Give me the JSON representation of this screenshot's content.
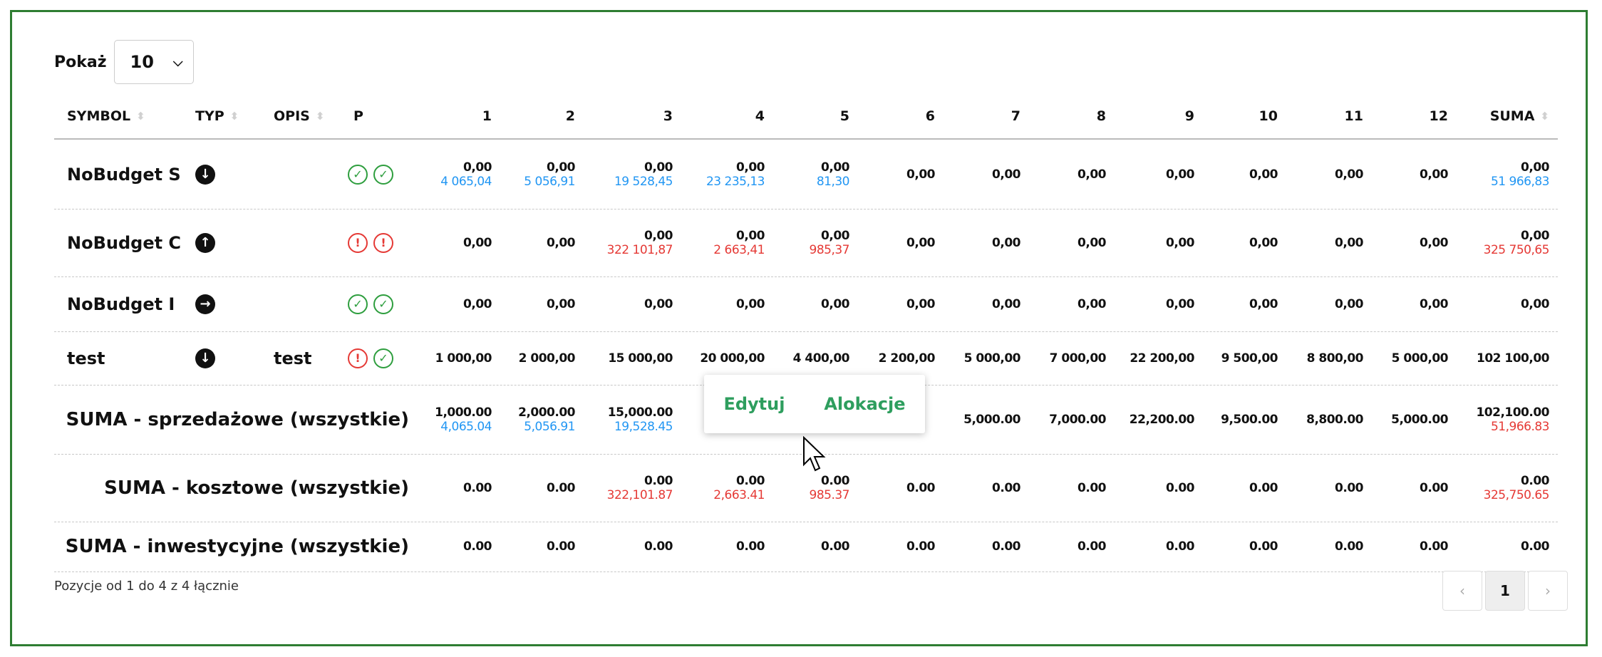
{
  "show": {
    "label": "Pokaż",
    "value": "10"
  },
  "headers": [
    "SYMBOL",
    "TYP",
    "OPIS",
    "P",
    "1",
    "2",
    "3",
    "4",
    "5",
    "6",
    "7",
    "8",
    "9",
    "10",
    "11",
    "12",
    "SUMA"
  ],
  "rows": [
    {
      "symbol": "NoBudget S",
      "type": "down-arrow-icon",
      "opis": "",
      "status": [
        "ok",
        "ok"
      ],
      "values": [
        [
          "0,00",
          "4 065,04"
        ],
        [
          "0,00",
          "5 056,91"
        ],
        [
          "0,00",
          "19 528,45"
        ],
        [
          "0,00",
          "23 235,13"
        ],
        [
          "0,00",
          "81,30"
        ],
        [
          "0,00"
        ],
        [
          "0,00"
        ],
        [
          "0,00"
        ],
        [
          "0,00"
        ],
        [
          "0,00"
        ],
        [
          "0,00"
        ],
        [
          "0,00"
        ]
      ],
      "suma": [
        "0,00",
        "51 966,83"
      ],
      "subcolor": "#2196f3"
    },
    {
      "symbol": "NoBudget C",
      "type": "up-arrow-icon",
      "opis": "",
      "status": [
        "warn",
        "warn"
      ],
      "values": [
        [
          "0,00"
        ],
        [
          "0,00"
        ],
        [
          "0,00",
          "322 101,87"
        ],
        [
          "0,00",
          "2 663,41"
        ],
        [
          "0,00",
          "985,37"
        ],
        [
          "0,00"
        ],
        [
          "0,00"
        ],
        [
          "0,00"
        ],
        [
          "0,00"
        ],
        [
          "0,00"
        ],
        [
          "0,00"
        ],
        [
          "0,00"
        ]
      ],
      "suma": [
        "0,00",
        "325 750,65"
      ],
      "subcolor": "#e53935"
    },
    {
      "symbol": "NoBudget I",
      "type": "right-arrow-icon",
      "opis": "",
      "status": [
        "ok",
        "ok"
      ],
      "values": [
        [
          "0,00"
        ],
        [
          "0,00"
        ],
        [
          "0,00"
        ],
        [
          "0,00"
        ],
        [
          "0,00"
        ],
        [
          "0,00"
        ],
        [
          "0,00"
        ],
        [
          "0,00"
        ],
        [
          "0,00"
        ],
        [
          "0,00"
        ],
        [
          "0,00"
        ],
        [
          "0,00"
        ]
      ],
      "suma": [
        "0,00"
      ],
      "subcolor": "#2196f3"
    },
    {
      "symbol": "test",
      "type": "down-arrow-icon",
      "opis": "test",
      "status": [
        "warn",
        "ok"
      ],
      "values": [
        [
          "1 000,00"
        ],
        [
          "2 000,00"
        ],
        [
          "15 000,00"
        ],
        [
          "20 000,00"
        ],
        [
          "4 400,00"
        ],
        [
          "2 200,00"
        ],
        [
          "5 000,00"
        ],
        [
          "7 000,00"
        ],
        [
          "22 200,00"
        ],
        [
          "9 500,00"
        ],
        [
          "8 800,00"
        ],
        [
          "5 000,00"
        ]
      ],
      "suma": [
        "102 100,00"
      ],
      "subcolor": "#2196f3"
    }
  ],
  "sums": [
    {
      "label": "SUMA - sprzedażowe (wszystkie)",
      "values": [
        [
          "1,000.00",
          "4,065.04"
        ],
        [
          "2,000.00",
          "5,056.91"
        ],
        [
          "15,000.00",
          "19,528.45"
        ],
        [
          ""
        ],
        [
          ""
        ],
        [
          ""
        ],
        [
          "5,000.00"
        ],
        [
          "7,000.00"
        ],
        [
          "22,200.00"
        ],
        [
          "9,500.00"
        ],
        [
          "8,800.00"
        ],
        [
          "5,000.00"
        ]
      ],
      "suma": [
        "102,100.00",
        "51,966.83"
      ],
      "subcolor": "#2196f3",
      "sumacolor": "#e53935"
    },
    {
      "label": "SUMA - kosztowe (wszystkie)",
      "values": [
        [
          "0.00"
        ],
        [
          "0.00"
        ],
        [
          "0.00",
          "322,101.87"
        ],
        [
          "0.00",
          "2,663.41"
        ],
        [
          "0.00",
          "985.37"
        ],
        [
          "0.00"
        ],
        [
          "0.00"
        ],
        [
          "0.00"
        ],
        [
          "0.00"
        ],
        [
          "0.00"
        ],
        [
          "0.00"
        ],
        [
          "0.00"
        ]
      ],
      "suma": [
        "0.00",
        "325,750.65"
      ],
      "subcolor": "#e53935",
      "sumacolor": "#e53935"
    },
    {
      "label": "SUMA - inwestycyjne (wszystkie)",
      "values": [
        [
          "0.00"
        ],
        [
          "0.00"
        ],
        [
          "0.00"
        ],
        [
          "0.00"
        ],
        [
          "0.00"
        ],
        [
          "0.00"
        ],
        [
          "0.00"
        ],
        [
          "0.00"
        ],
        [
          "0.00"
        ],
        [
          "0.00"
        ],
        [
          "0.00"
        ],
        [
          "0.00"
        ]
      ],
      "suma": [
        "0.00"
      ],
      "subcolor": "#2196f3",
      "sumacolor": "#e53935"
    }
  ],
  "context_menu": {
    "edit": "Edytuj",
    "alloc": "Alokacje"
  },
  "footer": {
    "info": "Pozycje od 1 do 4 z 4 łącznie",
    "page": "1",
    "prev": "‹",
    "next": "›"
  }
}
